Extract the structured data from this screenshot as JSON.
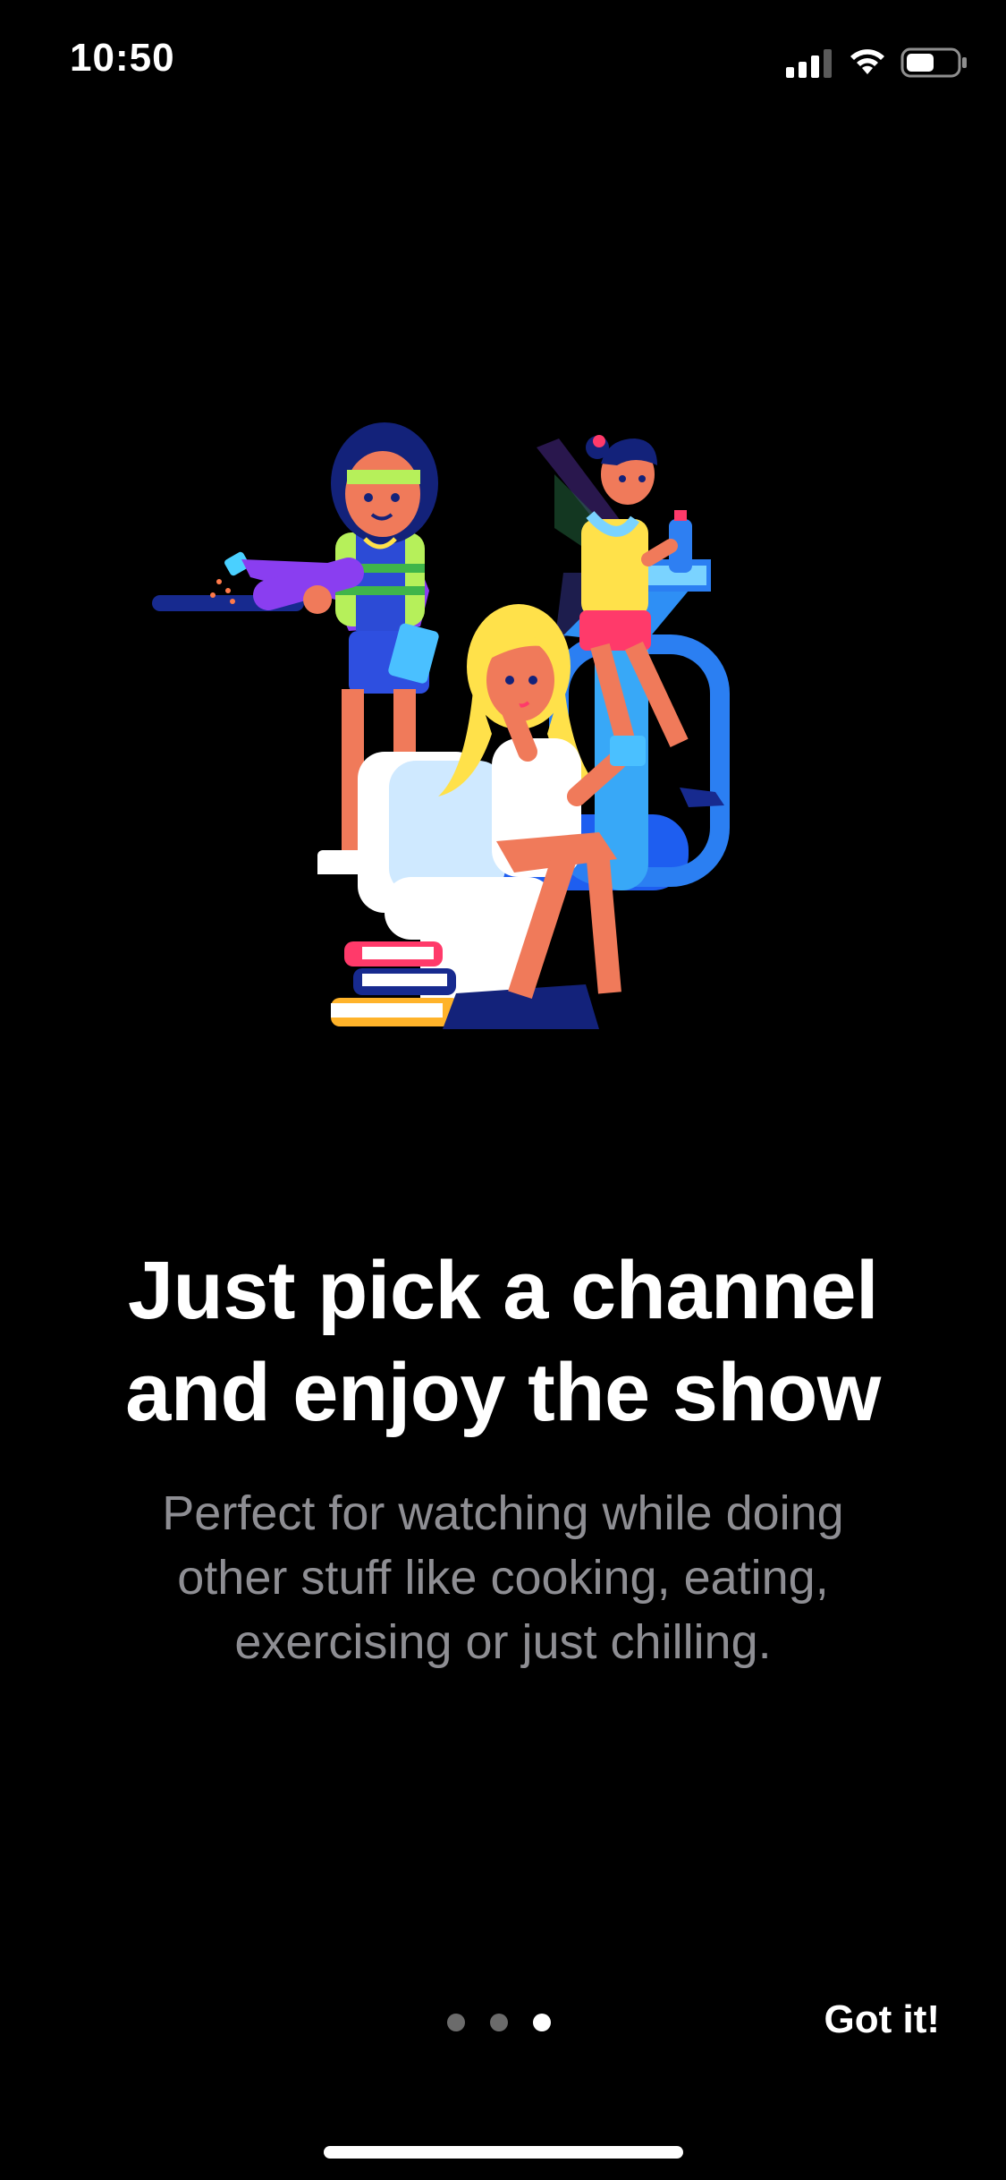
{
  "status_bar": {
    "time": "10:50",
    "icons": [
      "signal-icon",
      "wifi-icon",
      "battery-icon"
    ],
    "battery_level": 0.55
  },
  "onboarding": {
    "headline_line1": "Just pick a channel",
    "headline_line2": "and enjoy the show",
    "subtitle_line1": "Perfect for watching while doing",
    "subtitle_line2": "other stuff like cooking, eating,",
    "subtitle_line3": "exercising or just chilling.",
    "page_count": 3,
    "current_page": 3,
    "got_it_label": "Got it!"
  },
  "colors": {
    "background": "#000000",
    "text_primary": "#ffffff",
    "text_secondary": "#8e8e93",
    "dot_inactive": "#6b6b6b",
    "dot_active": "#ffffff"
  }
}
